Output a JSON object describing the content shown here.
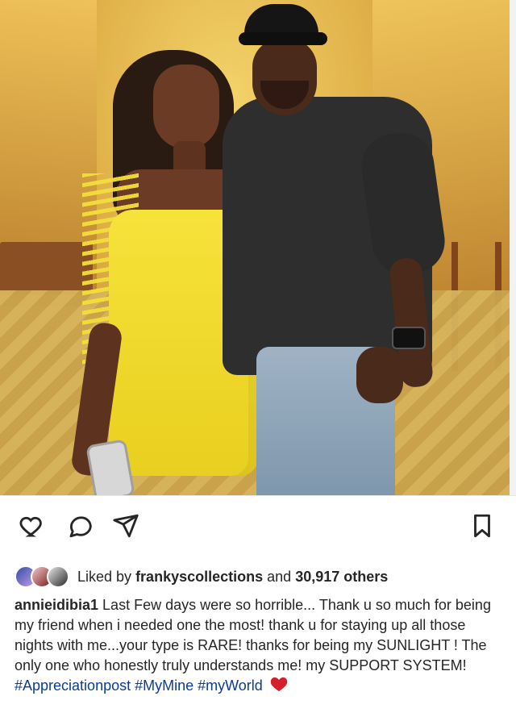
{
  "photo": {
    "alt": ""
  },
  "actions": {
    "like_icon": "heart-outline-icon",
    "comment_icon": "comment-bubble-icon",
    "share_icon": "paper-plane-icon",
    "save_icon": "bookmark-outline-icon"
  },
  "likes": {
    "prefix": "Liked by",
    "user": "frankyscollections",
    "middle": "and",
    "count_text": "30,917 others"
  },
  "caption": {
    "username": "annieidibia1",
    "text": "Last Few days were so horrible... Thank u so much for being my friend when i needed one the most! thank u for staying up all those nights with me...your type is RARE! thanks for being my SUNLIGHT ! The only one who honestly truly understands me! my SUPPORT SYSTEM!",
    "hashtags": "#Appreciationpost #MyMine #myWorld",
    "emoji_icon": "red-heart-icon"
  },
  "colors": {
    "hashtag": "#0a3d91",
    "heart_red": "#d61f2a",
    "text": "#262626"
  }
}
